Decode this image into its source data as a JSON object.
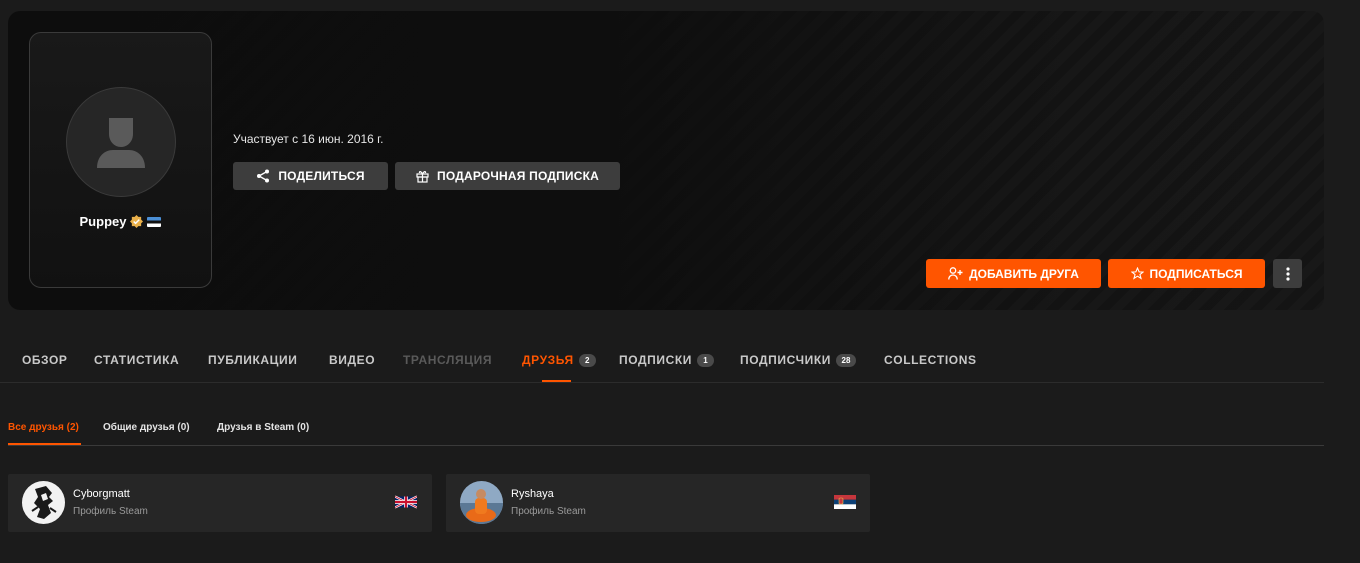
{
  "profile": {
    "nickname": "Puppey",
    "member_since": "Участвует с 16 июн. 2016 г."
  },
  "actions": {
    "share_label": "ПОДЕЛИТЬСЯ",
    "gift_label": "ПОДАРОЧНАЯ ПОДПИСКА",
    "add_friend_label": "ДОБАВИТЬ ДРУГА",
    "subscribe_label": "ПОДПИСАТЬСЯ"
  },
  "tabs": [
    {
      "label": "ОБЗОР"
    },
    {
      "label": "СТАТИСТИКА"
    },
    {
      "label": "ПУБЛИКАЦИИ"
    },
    {
      "label": "ВИДЕО"
    },
    {
      "label": "ТРАНСЛЯЦИЯ"
    },
    {
      "label": "ДРУЗЬЯ",
      "count": "2"
    },
    {
      "label": "ПОДПИСКИ",
      "count": "1"
    },
    {
      "label": "ПОДПИСЧИКИ",
      "count": "28"
    },
    {
      "label": "COLLECTIONS"
    }
  ],
  "subtabs": [
    {
      "label": "Все друзья (2)"
    },
    {
      "label": "Общие друзья (0)"
    },
    {
      "label": "Друзья в Steam (0)"
    }
  ],
  "friends": [
    {
      "name": "Cyborgmatt",
      "subtitle": "Профиль Steam",
      "flag": "gb-flag"
    },
    {
      "name": "Ryshaya",
      "subtitle": "Профиль Steam",
      "flag": "rs-flag"
    }
  ],
  "colors": {
    "accent": "#ff5500",
    "background": "#1b1b1b",
    "card": "#262626",
    "button_grey": "#3d3d3d"
  }
}
